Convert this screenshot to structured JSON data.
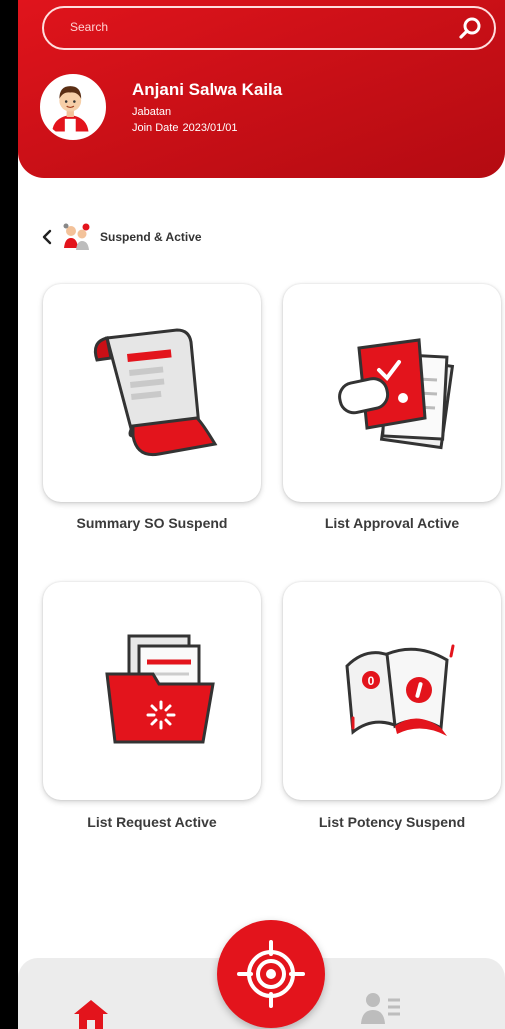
{
  "header": {
    "search": {
      "placeholder": "Search"
    },
    "user": {
      "name": "Anjani Salwa Kaila",
      "role": "Jabatan",
      "join_label": "Join Date",
      "join_date": "2023/01/01"
    }
  },
  "breadcrumb": {
    "label": "Suspend & Active"
  },
  "menu": [
    {
      "label": "Summary SO Suspend",
      "icon": "scroll-document-icon"
    },
    {
      "label": "List Approval Active",
      "icon": "approval-stamp-icon"
    },
    {
      "label": "List Request Active",
      "icon": "folder-loading-icon"
    },
    {
      "label": "List Potency Suspend",
      "icon": "warning-papers-icon"
    }
  ],
  "bottom_nav": {
    "items": [
      "home-icon",
      "target-icon",
      "profile-list-icon"
    ]
  },
  "colors": {
    "brand_red": "#e0141c",
    "card_bg": "#ffffff",
    "nav_bg": "#ececec",
    "label_text": "#3b3b3b"
  }
}
